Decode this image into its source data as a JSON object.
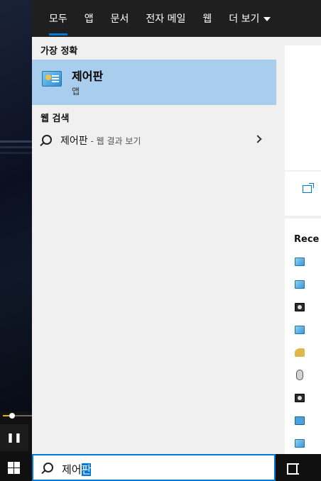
{
  "tabs": [
    {
      "label": "모두",
      "active": true
    },
    {
      "label": "앱",
      "active": false
    },
    {
      "label": "문서",
      "active": false
    },
    {
      "label": "전자 메일",
      "active": false
    },
    {
      "label": "웹",
      "active": false
    },
    {
      "label": "더 보기",
      "active": false
    }
  ],
  "best_match": {
    "section_title": "가장 정확",
    "title": "제어판",
    "subtitle": "앱",
    "icon": "control-panel-icon"
  },
  "web_search": {
    "section_title": "웹 검색",
    "query": "제어판",
    "suffix": " - 웹 결과 보기"
  },
  "preview": {
    "recent_label": "Rece",
    "recent_icons": [
      "control-panel-icon",
      "control-panel-icon",
      "camera-icon",
      "control-panel-icon",
      "key-icon",
      "mouse-icon",
      "camera-icon",
      "network-icon",
      "control-panel-icon"
    ]
  },
  "taskbar": {
    "search_text_plain": "제어",
    "search_text_selected": "판"
  },
  "colors": {
    "accent": "#0078d7",
    "selection": "#a9cdec",
    "tabbar": "#1f1f1f",
    "panel": "#f0f0f0"
  }
}
